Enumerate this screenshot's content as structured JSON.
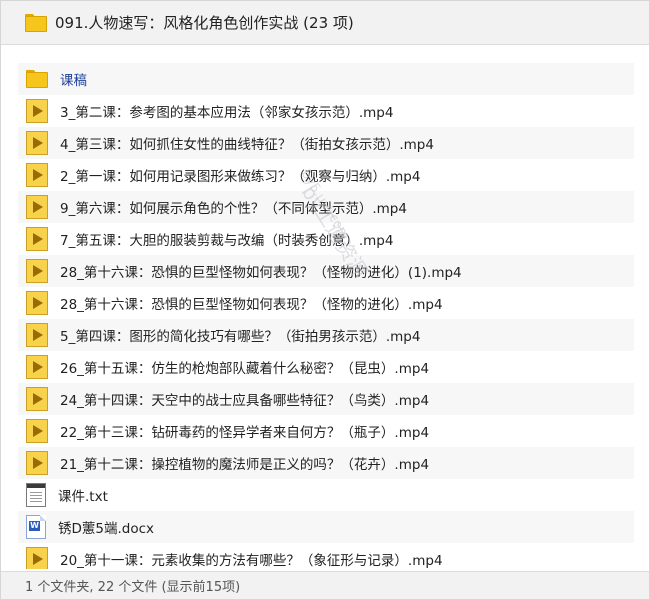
{
  "header": {
    "title": "091.人物速写：风格化角色创作实战 (23 项)",
    "icon": "folder-icon"
  },
  "files": [
    {
      "type": "folder",
      "name": "课稿"
    },
    {
      "type": "video",
      "name": "3_第二课：参考图的基本应用法（邻家女孩示范）.mp4"
    },
    {
      "type": "video",
      "name": "4_第三课：如何抓住女性的曲线特征？（街拍女孩示范）.mp4"
    },
    {
      "type": "video",
      "name": "2_第一课：如何用记录图形来做练习？（观察与归纳）.mp4"
    },
    {
      "type": "video",
      "name": "9_第六课：如何展示角色的个性？（不同体型示范）.mp4"
    },
    {
      "type": "video",
      "name": "7_第五课：大胆的服装剪裁与改编（时装秀创意）.mp4"
    },
    {
      "type": "video",
      "name": "28_第十六课：恐惧的巨型怪物如何表现？（怪物的进化）(1).mp4"
    },
    {
      "type": "video",
      "name": "28_第十六课：恐惧的巨型怪物如何表现？（怪物的进化）.mp4"
    },
    {
      "type": "video",
      "name": "5_第四课：图形的简化技巧有哪些？（街拍男孩示范）.mp4"
    },
    {
      "type": "video",
      "name": "26_第十五课：仿生的枪炮部队藏着什么秘密？（昆虫）.mp4"
    },
    {
      "type": "video",
      "name": "24_第十四课：天空中的战士应具备哪些特征？（鸟类）.mp4"
    },
    {
      "type": "video",
      "name": "22_第十三课：钻研毒药的怪异学者来自何方？（瓶子）.mp4"
    },
    {
      "type": "video",
      "name": "21_第十二课：操控植物的魔法师是正义的吗？（花卉）.mp4"
    },
    {
      "type": "txt",
      "name": "课件.txt"
    },
    {
      "type": "docx",
      "name": "锈D藼5端.docx",
      "icon_letter": "W"
    },
    {
      "type": "video",
      "name": "20_第十一课：元素收集的方法有哪些？（象征形与记录）.mp4"
    }
  ],
  "footer": {
    "status": "1 个文件夹, 22 个文件 (显示前15项)"
  },
  "watermark": {
    "text": "by工道资源",
    "url": "by5.uvi.com"
  },
  "colors": {
    "folder": "#f7c61c",
    "video": "#f8d24a",
    "folder_text": "#1f3f9a",
    "header_bg": "#f2f2f2"
  }
}
